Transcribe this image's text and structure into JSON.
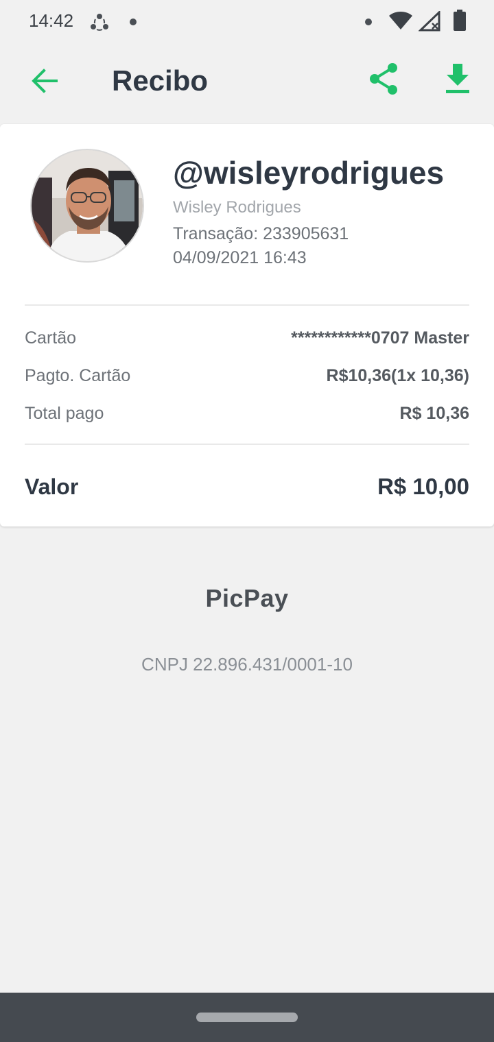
{
  "status_bar": {
    "time": "14:42",
    "icons": [
      "sync-icon",
      "notification-dot-icon",
      "dot-icon",
      "wifi-icon",
      "no-signal-icon",
      "battery-icon"
    ]
  },
  "app_bar": {
    "title": "Recibo",
    "back_icon": "arrow-left-icon",
    "share_icon": "share-icon",
    "download_icon": "download-icon",
    "accent_color": "#20c06a"
  },
  "receipt": {
    "username": "@wisleyrodrigues",
    "full_name": "Wisley Rodrigues",
    "transaction": "Transação: 233905631",
    "datetime": "04/09/2021 16:43",
    "details": [
      {
        "label": "Cartão",
        "value": "************0707 Master"
      },
      {
        "label": "Pagto. Cartão",
        "value": "R$10,36(1x 10,36)"
      },
      {
        "label": "Total pago",
        "value": "R$ 10,36"
      }
    ],
    "total": {
      "label": "Valor",
      "value": "R$ 10,00"
    }
  },
  "footer": {
    "brand": "PicPay",
    "cnpj": "CNPJ 22.896.431/0001-10"
  }
}
